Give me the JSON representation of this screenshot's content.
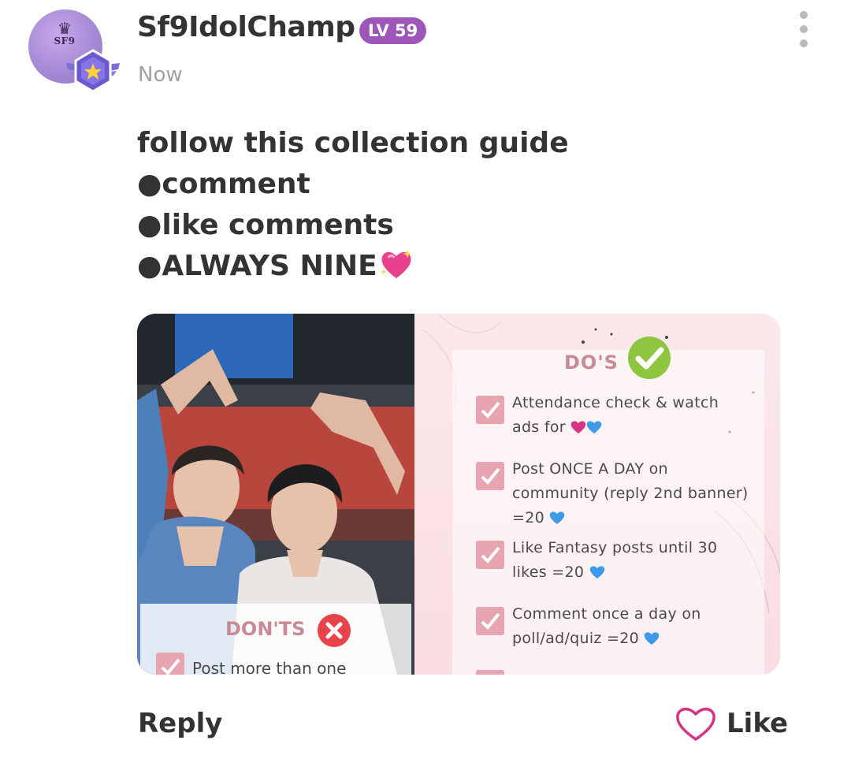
{
  "comment": {
    "username": "Sf9IdolChamp",
    "level_badge": "LV 59",
    "timestamp": "Now",
    "avatar_logo": "SF9",
    "menu_icon": "more-vertical-icon",
    "body_lines": [
      "follow this collection guide",
      "●comment",
      "●like comments",
      "●ALWAYS NINE"
    ],
    "body_emoji": "sparkling-heart-emoji"
  },
  "attachment": {
    "guide": {
      "dos_title": "DO'S",
      "items": [
        "Attendance  check & watch ads for",
        "Post ONCE A DAY on community (reply 2nd banner) =20",
        "Like Fantasy posts until 30 likes =20",
        "Comment once a day on poll/ad/quiz =20"
      ],
      "donts_title": "DON'TS",
      "donts_item": "Post more than one"
    }
  },
  "actions": {
    "reply_label": "Reply",
    "like_label": "Like"
  },
  "colors": {
    "level_badge": "#9c57b8",
    "like_heart": "#d63384",
    "timestamp": "#a2a2a2"
  }
}
